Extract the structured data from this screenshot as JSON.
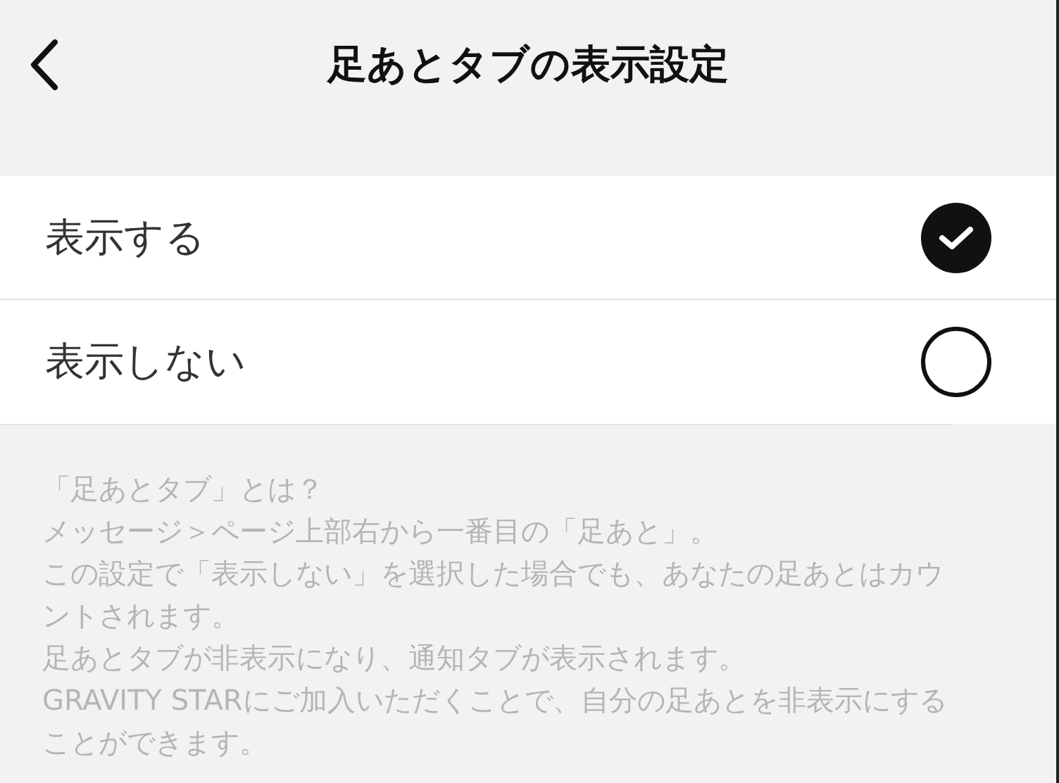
{
  "header": {
    "title": "足あとタブの表示設定"
  },
  "options": [
    {
      "label": "表示する",
      "selected": true
    },
    {
      "label": "表示しない",
      "selected": false
    }
  ],
  "notes": [
    "「足あとタブ」とは？",
    "メッセージ＞ページ上部右から一番目の「足あと」。",
    "この設定で「表示しない」を選択した場合でも、あなたの足あとはカウントされます。",
    "足あとタブが非表示になり、通知タブが表示されます。",
    "GRAVITY STARにご加入いただくことで、自分の足あとを非表示にすることができます。"
  ]
}
